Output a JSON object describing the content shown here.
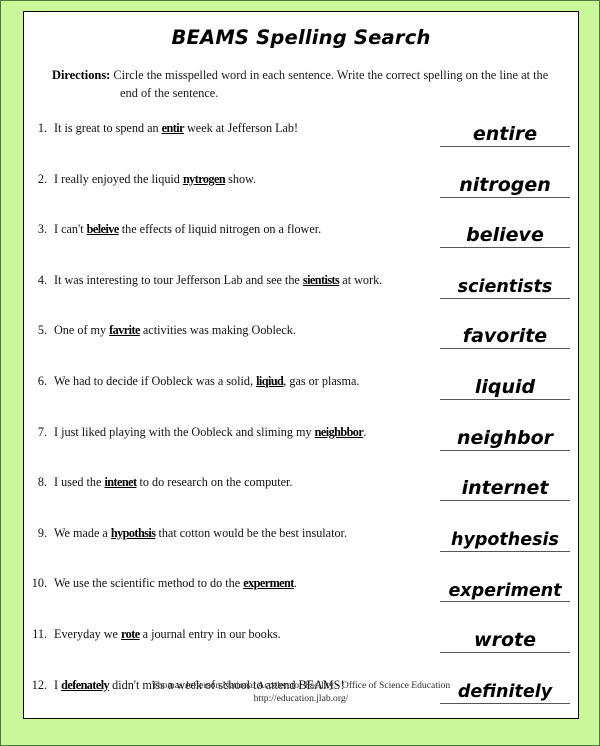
{
  "page": {
    "title": "BEAMS Spelling Search",
    "border_color": "#c9f79a",
    "frame_color": "#000000"
  },
  "directions": {
    "label": "Directions:",
    "line1": "Circle the misspelled word in each sentence. Write the correct spelling on the line at the",
    "line2": "end of the sentence."
  },
  "questions": [
    {
      "number": "1.",
      "before": "It is great to spend an ",
      "misspelled": "entir",
      "after": " week at Jefferson Lab!",
      "answer": "entire"
    },
    {
      "number": "2.",
      "before": "I really enjoyed the liquid ",
      "misspelled": "nytrogen",
      "after": " show.",
      "answer": "nitrogen"
    },
    {
      "number": "3.",
      "before": "I can't ",
      "misspelled": "beleive",
      "after": " the effects of liquid nitrogen on a flower.",
      "answer": "believe"
    },
    {
      "number": "4.",
      "before": "It was interesting to tour Jefferson Lab and see the ",
      "misspelled": "sientists",
      "after": " at work.",
      "answer": "scientists"
    },
    {
      "number": "5.",
      "before": "One of my ",
      "misspelled": "favrite",
      "after": " activities was making Oobleck.",
      "answer": "favorite"
    },
    {
      "number": "6.",
      "before": "We had to decide if Oobleck was a solid, ",
      "misspelled": "liqiud",
      "after": ", gas or plasma.",
      "answer": "liquid"
    },
    {
      "number": "7.",
      "before": "I just liked playing with the Oobleck and sliming my ",
      "misspelled": "neighbbor",
      "after": ".",
      "answer": "neighbor"
    },
    {
      "number": "8.",
      "before": "I used the ",
      "misspelled": "intenet",
      "after": " to do research on the computer.",
      "answer": "internet"
    },
    {
      "number": "9.",
      "before": "We made a ",
      "misspelled": "hypothsis",
      "after": " that cotton would be the best insulator.",
      "answer": "hypothesis"
    },
    {
      "number": "10.",
      "before": "We use the scientific method to do the ",
      "misspelled": "experment",
      "after": ".",
      "answer": "experiment"
    },
    {
      "number": "11.",
      "before": "Everyday we ",
      "misspelled": "rote",
      "after": " a journal entry in our books.",
      "answer": "wrote"
    },
    {
      "number": "12.",
      "before": "I ",
      "misspelled": "defenately",
      "after": " didn't miss a week of school to attend BEAMS!",
      "answer": "definitely"
    }
  ],
  "footer": {
    "organization": "Thomas Jefferson National Accelerator Facility - Office of Science Education",
    "url": "http://education.jlab.org/"
  }
}
